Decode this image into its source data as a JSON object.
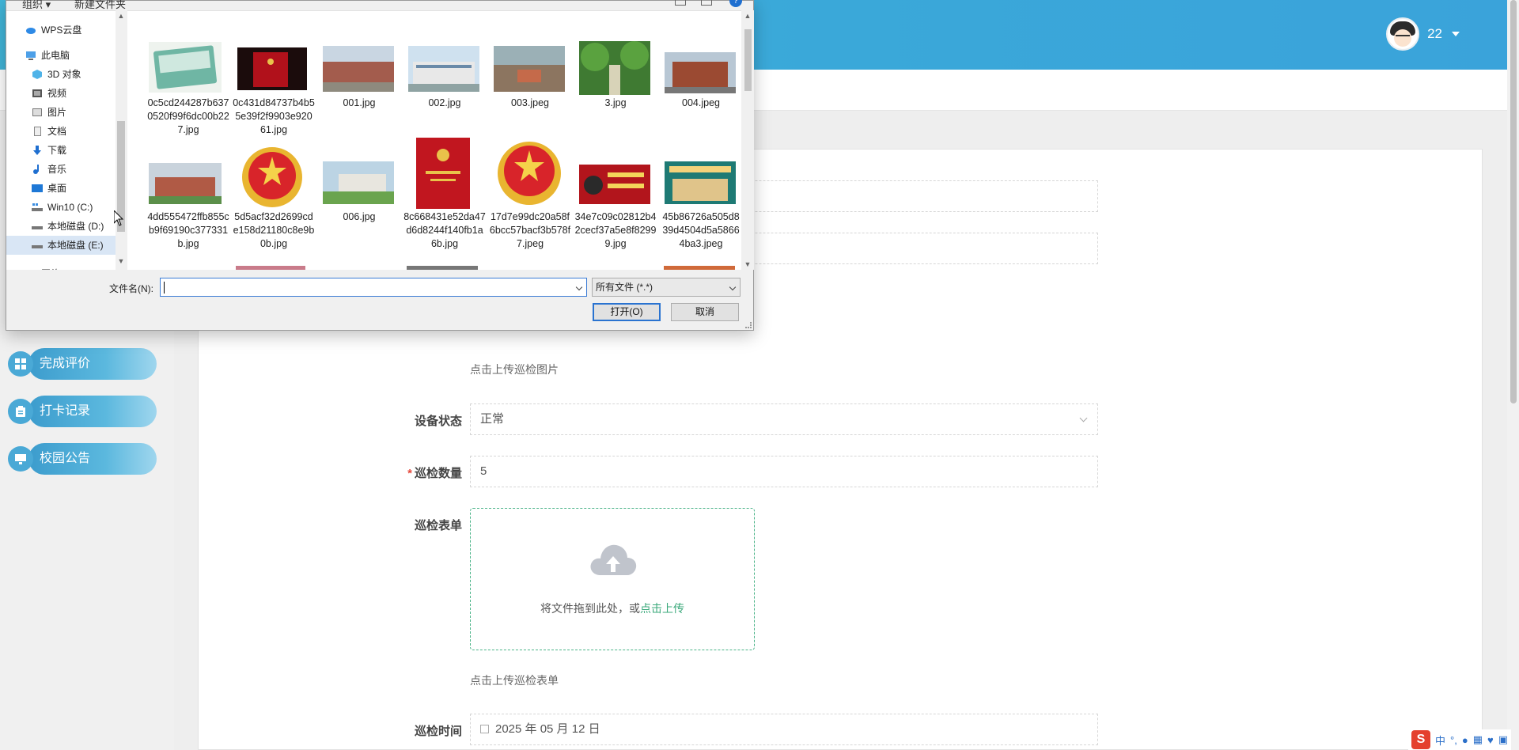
{
  "header": {
    "user_name": "22"
  },
  "sidebar": {
    "items": [
      {
        "label": "完成评价",
        "icon": "grid-icon"
      },
      {
        "label": "打卡记录",
        "icon": "clipboard-icon"
      },
      {
        "label": "校园公告",
        "icon": "monitor-icon"
      }
    ]
  },
  "form": {
    "inspection_image_hint": "点击上传巡检图片",
    "device_status_label": "设备状态",
    "device_status_value": "正常",
    "inspection_count_label": "巡检数量",
    "inspection_count_value": "5",
    "inspection_form_label": "巡检表单",
    "upload_text": "将文件拖到此处，或",
    "upload_link": "点击上传",
    "inspection_form_hint": "点击上传巡检表单",
    "inspection_time_label": "巡检时间",
    "inspection_time_value": "2025 年 05 月 12 日"
  },
  "dialog": {
    "toolbar": {
      "organize": "组织 ▾",
      "new_folder": "新建文件夹"
    },
    "tree": [
      {
        "label": "WPS云盘",
        "icon": "cloud-icon"
      },
      {
        "label": "此电脑",
        "icon": "computer-icon"
      },
      {
        "label": "3D 对象",
        "icon": "cube-icon"
      },
      {
        "label": "视频",
        "icon": "video-icon"
      },
      {
        "label": "图片",
        "icon": "picture-icon"
      },
      {
        "label": "文档",
        "icon": "document-icon"
      },
      {
        "label": "下载",
        "icon": "download-icon"
      },
      {
        "label": "音乐",
        "icon": "music-icon"
      },
      {
        "label": "桌面",
        "icon": "desktop-icon"
      },
      {
        "label": "Win10 (C:)",
        "icon": "drive-c-icon"
      },
      {
        "label": "本地磁盘 (D:)",
        "icon": "drive-icon"
      },
      {
        "label": "本地磁盘 (E:)",
        "icon": "drive-icon"
      },
      {
        "label": "网络",
        "icon": "network-icon"
      }
    ],
    "files": [
      {
        "name": "0c5cd244287b6370520f99f6dc00b227.jpg"
      },
      {
        "name": "0c431d84737b4b55e39f2f9903e92061.jpg"
      },
      {
        "name": "001.jpg"
      },
      {
        "name": "002.jpg"
      },
      {
        "name": "003.jpeg"
      },
      {
        "name": "3.jpg"
      },
      {
        "name": "004.jpeg"
      },
      {
        "name": "4dd555472ffb855cb9f69190c377331b.jpg"
      },
      {
        "name": "5d5acf32d2699cde158d21180c8e9b0b.jpg"
      },
      {
        "name": "006.jpg"
      },
      {
        "name": "8c668431e52da47d6d8244f140fb1a6b.jpg"
      },
      {
        "name": "17d7e99dc20a58f6bcc57bacf3b578f7.jpeg"
      },
      {
        "name": "34e7c09c02812b42cecf37a5e8f82999.jpg"
      },
      {
        "name": "45b86726a505d839d4504d5a58664ba3.jpeg"
      }
    ],
    "filename_label": "文件名(N):",
    "filename_value": "",
    "filetype_value": "所有文件 (*.*)",
    "open_button": "打开(O)",
    "cancel_button": "取消"
  },
  "tray": {
    "ime_label": "中"
  },
  "colors": {
    "header_blue": "#3aa8d9",
    "nav_pill_blue": "#4aa9d6",
    "upload_green": "#3aa87a",
    "required_red": "#e5483b",
    "dialog_accent": "#2a73d0"
  }
}
